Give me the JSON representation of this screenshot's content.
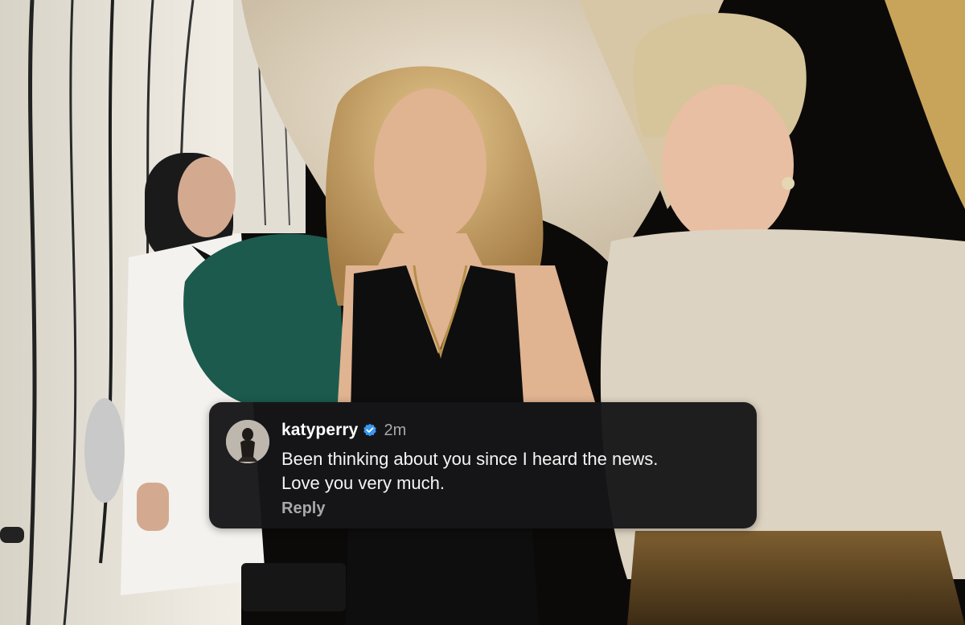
{
  "comment": {
    "username": "katyperry",
    "verified": true,
    "timestamp": "2m",
    "text_lines": [
      "Been thinking about you since I heard the news.",
      "Love you very much."
    ],
    "reply_label": "Reply",
    "avatar_icon": "profile-photo"
  },
  "colors": {
    "card_bg": "#161618",
    "verified_blue": "#3897f0",
    "secondary_text": "#a8a8a8"
  }
}
